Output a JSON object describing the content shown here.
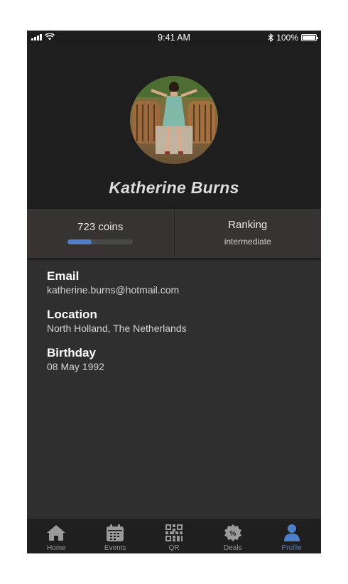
{
  "status_bar": {
    "time": "9:41 AM",
    "battery": "100%"
  },
  "profile": {
    "name": "Katherine Burns"
  },
  "stats": {
    "coins_label": "723 coins",
    "coins_progress_fraction": 0.37,
    "ranking_title": "Ranking",
    "ranking_value": "intermediate"
  },
  "fields": [
    {
      "label": "Email",
      "value": "katherine.burns@hotmail.com"
    },
    {
      "label": "Location",
      "value": "North Holland, The Netherlands"
    },
    {
      "label": "Birthday",
      "value": "08 May 1992"
    }
  ],
  "tabs": [
    {
      "label": "Home",
      "icon": "home-icon"
    },
    {
      "label": "Events",
      "icon": "calendar-icon"
    },
    {
      "label": "QR",
      "icon": "qr-code-icon"
    },
    {
      "label": "Deals",
      "icon": "deals-badge-icon"
    },
    {
      "label": "Profile",
      "icon": "person-icon",
      "active": true
    }
  ],
  "colors": {
    "accent": "#4f7fc8",
    "header_bg": "#1e1e1e",
    "body_bg": "#2f2f2f",
    "stats_bg": "#383333",
    "tab_inactive": "#9a9a9a"
  }
}
